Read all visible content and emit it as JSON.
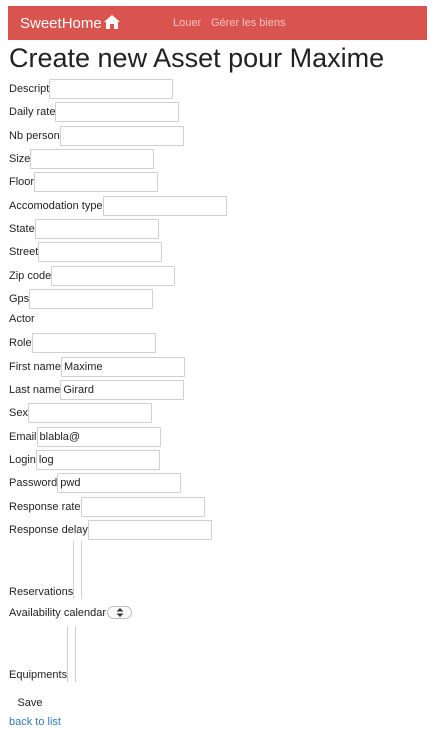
{
  "navbar": {
    "brand": "SweetHome",
    "home_icon": "home-icon",
    "links": [
      "Louer",
      "Gérer les biens"
    ],
    "background": "#d9534f"
  },
  "page": {
    "title": "Create new Asset pour Maxime"
  },
  "form": {
    "descript": {
      "label": "Descript",
      "value": ""
    },
    "daily_rate": {
      "label": "Daily rate",
      "value": ""
    },
    "nb_person": {
      "label": "Nb person",
      "value": ""
    },
    "size": {
      "label": "Size",
      "value": ""
    },
    "floor": {
      "label": "Floor",
      "value": ""
    },
    "accomodation_type": {
      "label": "Accomodation type",
      "value": ""
    },
    "state": {
      "label": "State",
      "value": ""
    },
    "street": {
      "label": "Street",
      "value": ""
    },
    "zip_code": {
      "label": "Zip code",
      "value": ""
    },
    "gps": {
      "label": "Gps",
      "value": ""
    },
    "actor": {
      "label": "Actor"
    },
    "role": {
      "label": "Role",
      "value": ""
    },
    "first_name": {
      "label": "First name",
      "value": "Maxime"
    },
    "last_name": {
      "label": "Last name",
      "value": "Girard"
    },
    "sex": {
      "label": "Sex",
      "value": ""
    },
    "email": {
      "label": "Email",
      "value": "blabla@"
    },
    "login": {
      "label": "Login",
      "value": "log"
    },
    "password": {
      "label": "Password",
      "value": "pwd"
    },
    "response_rate": {
      "label": "Response rate",
      "value": ""
    },
    "response_delay": {
      "label": "Response delay",
      "value": ""
    },
    "reservations": {
      "label": "Reservations"
    },
    "availability_calendar": {
      "label": "Availability calendar",
      "icon": "select-arrows-icon"
    },
    "equipments": {
      "label": "Equipments"
    }
  },
  "actions": {
    "save_label": "Save",
    "back_label": "back to list"
  }
}
